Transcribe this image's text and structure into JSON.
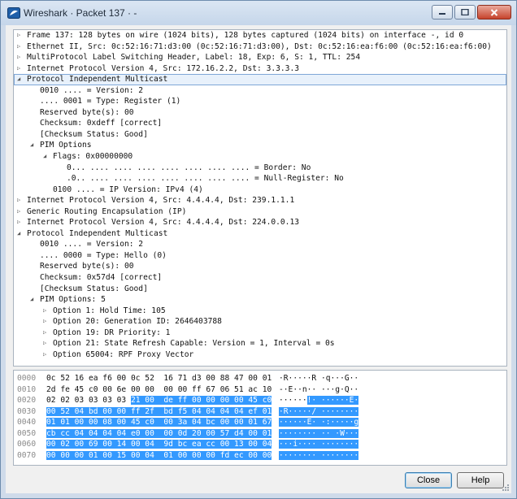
{
  "window": {
    "title": "Wireshark · Packet 137 · -"
  },
  "tree": [
    {
      "text": "Frame 137: 128 bytes on wire (1024 bits), 128 bytes captured (1024 bits) on interface -, id 0",
      "indent": 0,
      "toggle": "collapsed"
    },
    {
      "text": "Ethernet II, Src: 0c:52:16:71:d3:00 (0c:52:16:71:d3:00), Dst: 0c:52:16:ea:f6:00 (0c:52:16:ea:f6:00)",
      "indent": 0,
      "toggle": "collapsed"
    },
    {
      "text": "MultiProtocol Label Switching Header, Label: 18, Exp: 6, S: 1, TTL: 254",
      "indent": 0,
      "toggle": "collapsed"
    },
    {
      "text": "Internet Protocol Version 4, Src: 172.16.2.2, Dst: 3.3.3.3",
      "indent": 0,
      "toggle": "collapsed"
    },
    {
      "text": "Protocol Independent Multicast",
      "indent": 0,
      "toggle": "expanded",
      "selected": true
    },
    {
      "text": "0010 .... = Version: 2",
      "indent": 1
    },
    {
      "text": ".... 0001 = Type: Register (1)",
      "indent": 1
    },
    {
      "text": "Reserved byte(s): 00",
      "indent": 1
    },
    {
      "text": "Checksum: 0xdeff [correct]",
      "indent": 1
    },
    {
      "text": "[Checksum Status: Good]",
      "indent": 1
    },
    {
      "text": "PIM Options",
      "indent": 1,
      "toggle": "expanded"
    },
    {
      "text": "Flags: 0x00000000",
      "indent": 2,
      "toggle": "expanded"
    },
    {
      "text": "0... .... .... .... .... .... .... .... = Border: No",
      "indent": 3
    },
    {
      "text": ".0.. .... .... .... .... .... .... .... = Null-Register: No",
      "indent": 3
    },
    {
      "text": "0100 .... = IP Version: IPv4 (4)",
      "indent": 2
    },
    {
      "text": "Internet Protocol Version 4, Src: 4.4.4.4, Dst: 239.1.1.1",
      "indent": 0,
      "toggle": "collapsed"
    },
    {
      "text": "Generic Routing Encapsulation (IP)",
      "indent": 0,
      "toggle": "collapsed"
    },
    {
      "text": "Internet Protocol Version 4, Src: 4.4.4.4, Dst: 224.0.0.13",
      "indent": 0,
      "toggle": "collapsed"
    },
    {
      "text": "Protocol Independent Multicast",
      "indent": 0,
      "toggle": "expanded"
    },
    {
      "text": "0010 .... = Version: 2",
      "indent": 1
    },
    {
      "text": ".... 0000 = Type: Hello (0)",
      "indent": 1
    },
    {
      "text": "Reserved byte(s): 00",
      "indent": 1
    },
    {
      "text": "Checksum: 0x57d4 [correct]",
      "indent": 1
    },
    {
      "text": "[Checksum Status: Good]",
      "indent": 1
    },
    {
      "text": "PIM Options: 5",
      "indent": 1,
      "toggle": "expanded"
    },
    {
      "text": "Option 1: Hold Time: 105",
      "indent": 2,
      "toggle": "collapsed"
    },
    {
      "text": "Option 20: Generation ID: 2646403788",
      "indent": 2,
      "toggle": "collapsed"
    },
    {
      "text": "Option 19: DR Priority: 1",
      "indent": 2,
      "toggle": "collapsed"
    },
    {
      "text": "Option 21: State Refresh Capable: Version = 1, Interval = 0s",
      "indent": 2,
      "toggle": "collapsed"
    },
    {
      "text": "Option 65004: RPF Proxy Vector",
      "indent": 2,
      "toggle": "collapsed"
    }
  ],
  "bytes": [
    {
      "offset": "0000",
      "hex": "0c 52 16 ea f6 00 0c 52  16 71 d3 00 88 47 00 01",
      "ascii": "·R·····R ·q···G··",
      "hex_sel_from": -1,
      "ascii_sel_from": -1
    },
    {
      "offset": "0010",
      "hex": "2d fe 45 c0 00 6e 00 00  00 00 ff 67 06 51 ac 10",
      "ascii": "-·E··n·· ···g·Q··",
      "hex_sel_from": -1,
      "ascii_sel_from": -1
    },
    {
      "offset": "0020",
      "hex": "02 02 03 03 03 03 21 00  de ff 00 00 00 00 45 c0",
      "ascii": "······!· ······E·",
      "hex_sel_from": 18,
      "ascii_sel_from": 6
    },
    {
      "offset": "0030",
      "hex": "00 52 04 bd 00 00 ff 2f  bd f5 04 04 04 04 ef 01",
      "ascii": "·R·····/ ········",
      "hex_sel_from": 0,
      "ascii_sel_from": 0
    },
    {
      "offset": "0040",
      "hex": "01 01 00 00 08 00 45 c0  00 3a 04 bc 00 00 01 67",
      "ascii": "······E· ·:·····g",
      "hex_sel_from": 0,
      "ascii_sel_from": 0
    },
    {
      "offset": "0050",
      "hex": "cb cc 04 04 04 04 e0 00  00 0d 20 00 57 d4 00 01",
      "ascii": "········ ·· ·W···",
      "hex_sel_from": 0,
      "ascii_sel_from": 0
    },
    {
      "offset": "0060",
      "hex": "00 02 00 69 00 14 00 04  9d bc ea cc 00 13 00 04",
      "ascii": "···i···· ········",
      "hex_sel_from": 0,
      "ascii_sel_from": 0
    },
    {
      "offset": "0070",
      "hex": "00 00 00 01 00 15 00 04  01 00 00 00 fd ec 00 00",
      "ascii": "········ ········",
      "hex_sel_from": 0,
      "ascii_sel_from": 0
    }
  ],
  "buttons": {
    "close": "Close",
    "help": "Help"
  },
  "colors": {
    "selection": "#3399ff",
    "selected_row": "#e8f1fb"
  }
}
